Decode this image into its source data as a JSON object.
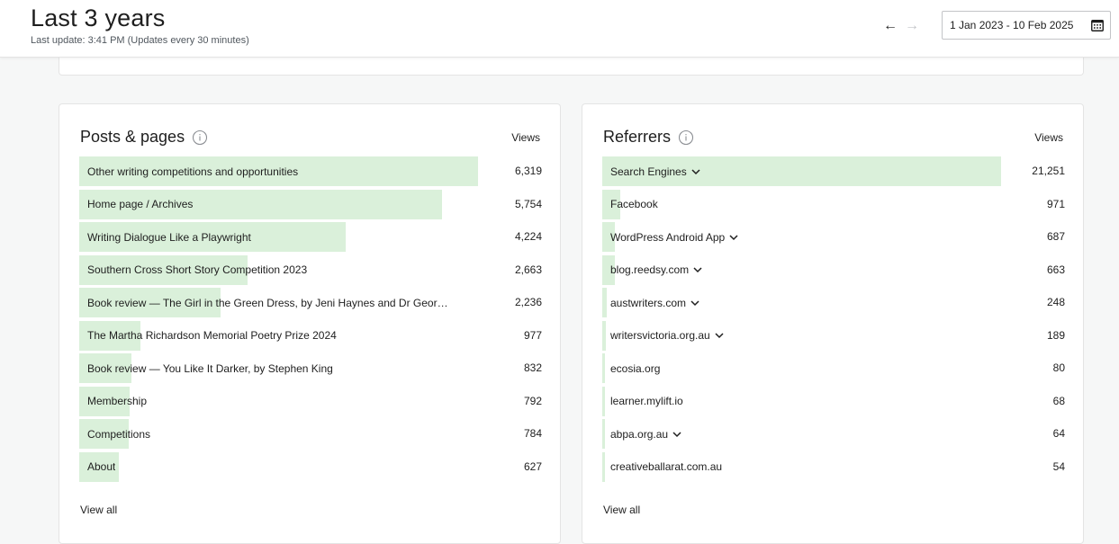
{
  "header": {
    "title": "Last 3 years",
    "subtitle": "Last update: 3:41 PM (Updates every 30 minutes)",
    "prev_arrow": "←",
    "next_arrow": "→",
    "date_range": "1 Jan 2023 - 10 Feb 2025",
    "calendar_icon": "calendar-icon"
  },
  "colors": {
    "bar": "#daf0da",
    "text": "#1e1e1e",
    "muted": "#50575e",
    "border": "#e4e4e4"
  },
  "posts": {
    "title": "Posts & pages",
    "views_label": "Views",
    "view_all": "View all",
    "max": 6319,
    "items": [
      {
        "label": "Other writing competitions and opportunities",
        "value": "6,319",
        "views": 6319
      },
      {
        "label": "Home page / Archives",
        "value": "5,754",
        "views": 5754
      },
      {
        "label": "Writing Dialogue Like a Playwright",
        "value": "4,224",
        "views": 4224
      },
      {
        "label": "Southern Cross Short Story Competition 2023",
        "value": "2,663",
        "views": 2663
      },
      {
        "label": "Book review — The Girl in the Green Dress, by Jeni Haynes and Dr Geor…",
        "value": "2,236",
        "views": 2236
      },
      {
        "label": "The Martha Richardson Memorial Poetry Prize 2024",
        "value": "977",
        "views": 977
      },
      {
        "label": "Book review — You Like It Darker, by Stephen King",
        "value": "832",
        "views": 832
      },
      {
        "label": "Membership",
        "value": "792",
        "views": 792
      },
      {
        "label": "Competitions",
        "value": "784",
        "views": 784
      },
      {
        "label": "About",
        "value": "627",
        "views": 627
      }
    ]
  },
  "referrers": {
    "title": "Referrers",
    "views_label": "Views",
    "view_all": "View all",
    "max": 21251,
    "items": [
      {
        "label": "Search Engines",
        "value": "21,251",
        "views": 21251,
        "expandable": true
      },
      {
        "label": "Facebook",
        "value": "971",
        "views": 971,
        "expandable": false
      },
      {
        "label": "WordPress Android App",
        "value": "687",
        "views": 687,
        "expandable": true
      },
      {
        "label": "blog.reedsy.com",
        "value": "663",
        "views": 663,
        "expandable": true
      },
      {
        "label": "austwriters.com",
        "value": "248",
        "views": 248,
        "expandable": true
      },
      {
        "label": "writersvictoria.org.au",
        "value": "189",
        "views": 189,
        "expandable": true
      },
      {
        "label": "ecosia.org",
        "value": "80",
        "views": 80,
        "expandable": false
      },
      {
        "label": "learner.mylift.io",
        "value": "68",
        "views": 68,
        "expandable": false
      },
      {
        "label": "abpa.org.au",
        "value": "64",
        "views": 64,
        "expandable": true
      },
      {
        "label": "creativeballarat.com.au",
        "value": "54",
        "views": 54,
        "expandable": false
      }
    ]
  }
}
